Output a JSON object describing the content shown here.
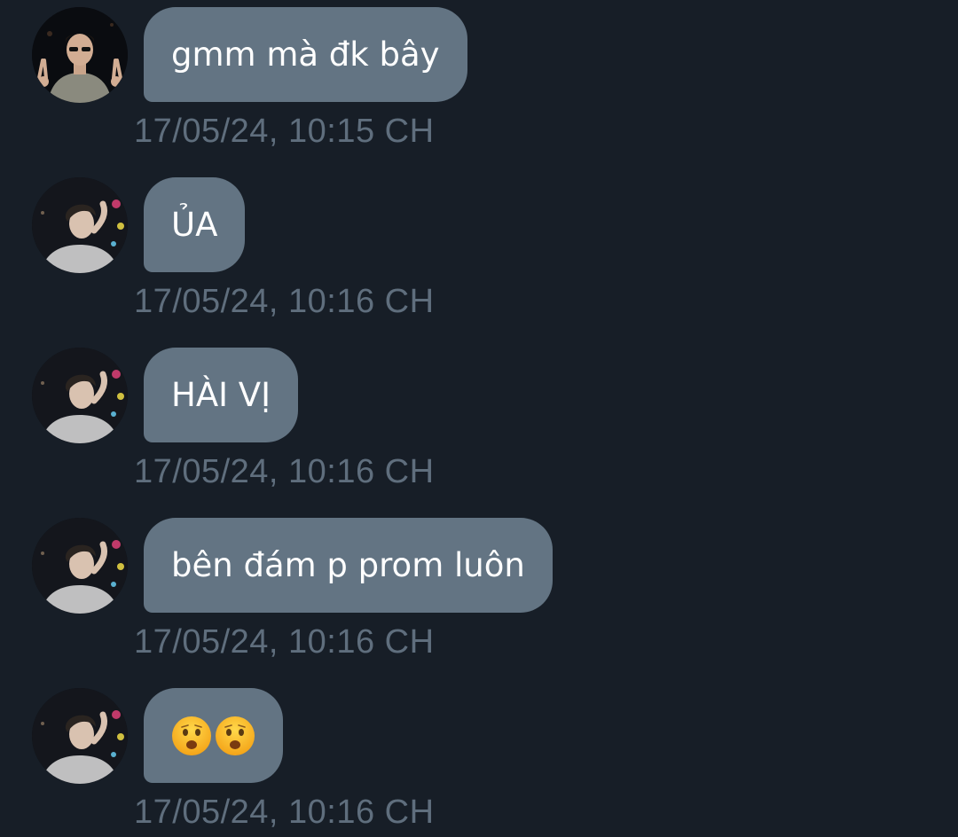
{
  "messages": [
    {
      "text": "gmm mà đk bây",
      "time": "17/05/24, 10:15 CH",
      "avatar": "avatar-user-a",
      "type": "text"
    },
    {
      "text": "ỦA",
      "time": "17/05/24, 10:16 CH",
      "avatar": "avatar-user-b",
      "type": "text"
    },
    {
      "text": "HÀI VỊ",
      "time": "17/05/24, 10:16 CH",
      "avatar": "avatar-user-b",
      "type": "text"
    },
    {
      "text": "bên đám p prom luôn",
      "time": "17/05/24, 10:16 CH",
      "avatar": "avatar-user-b",
      "type": "text"
    },
    {
      "emojis": [
        "frowning-open-mouth-emoji",
        "frowning-open-mouth-emoji"
      ],
      "time": "17/05/24, 10:16 CH",
      "avatar": "avatar-user-b",
      "type": "emoji"
    }
  ],
  "colors": {
    "background": "#171e27",
    "bubble": "#637483",
    "bubble_text": "#ffffff",
    "timestamp": "#5f6e7d"
  }
}
